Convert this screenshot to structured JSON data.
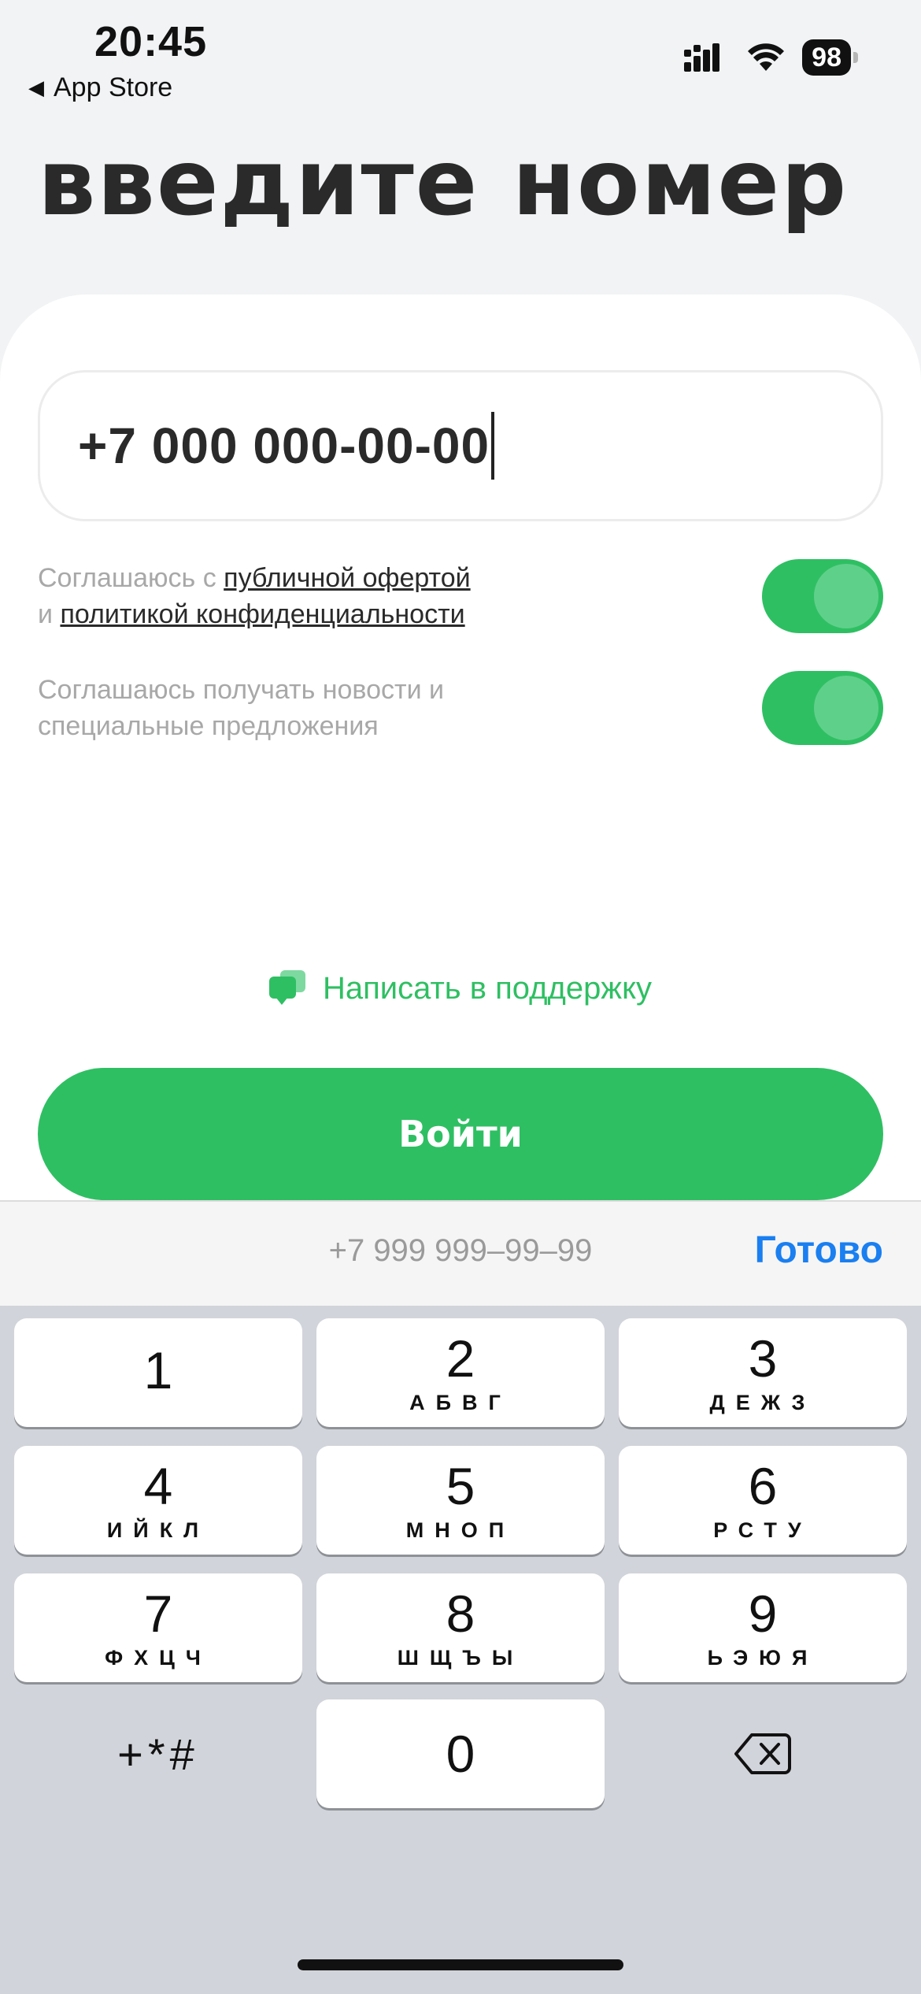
{
  "status_bar": {
    "time": "20:45",
    "back_label": "App Store",
    "battery": "98"
  },
  "title": "введите номер",
  "phone": {
    "value": "+7 000 000-00-00"
  },
  "consents": [
    {
      "prefix": "Соглашаюсь с ",
      "link1": "публичной офертой",
      "middle": "и ",
      "link2": "политикой конфиденциальности",
      "enabled": true
    },
    {
      "text": "Соглашаюсь получать новости и специальные предложения",
      "enabled": true
    }
  ],
  "support_label": "Написать в поддержку",
  "login_label": "Войти",
  "keyboard": {
    "placeholder_hint": "+7 999 999–99–99",
    "done_label": "Готово",
    "keys": [
      {
        "digit": "1",
        "letters": ""
      },
      {
        "digit": "2",
        "letters": "АБВГ"
      },
      {
        "digit": "3",
        "letters": "ДЕЖЗ"
      },
      {
        "digit": "4",
        "letters": "ИЙКЛ"
      },
      {
        "digit": "5",
        "letters": "МНОП"
      },
      {
        "digit": "6",
        "letters": "РСТУ"
      },
      {
        "digit": "7",
        "letters": "ФХЦЧ"
      },
      {
        "digit": "8",
        "letters": "ШЩЪЫ"
      },
      {
        "digit": "9",
        "letters": "ЬЭЮЯ"
      },
      {
        "digit": "0",
        "letters": ""
      }
    ],
    "symbols_label": "+*#"
  },
  "colors": {
    "accent": "#2fbf63",
    "done": "#1a7ff0",
    "background": "#f2f3f5"
  },
  "icons": [
    "back-triangle-icon",
    "signal-icon",
    "wifi-icon",
    "battery-icon",
    "chat-icon",
    "backspace-icon"
  ]
}
